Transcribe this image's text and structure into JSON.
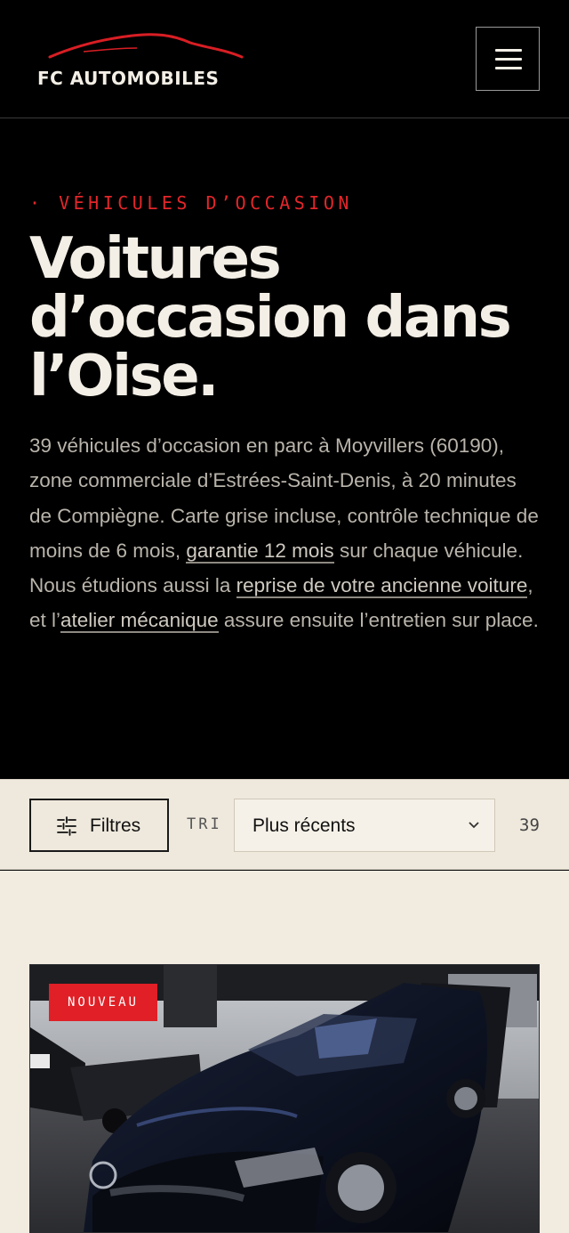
{
  "header": {
    "brand": "FC AUTOMOBILES",
    "logo_icon": "car-silhouette-icon",
    "menu_icon": "hamburger-menu-icon"
  },
  "hero": {
    "eyebrow": "· VÉHICULES D’OCCASION",
    "title_lines": [
      "Voitures",
      "d’occasion dans",
      "l’Oise."
    ],
    "description": {
      "part1": "39 véhicules d’occasion en parc à Moyvillers (60190), zone commerciale d’Estrées-Saint-Denis, à 20 minutes de Compiègne. Carte grise incluse, contrôle technique de moins de 6 mois, ",
      "link1": "garantie 12 mois",
      "part2": " sur chaque véhicule. Nous étudions aussi la ",
      "link2": "reprise de votre ancienne voiture",
      "part3": ", et l’",
      "link3": "atelier mécanique",
      "part4": " assure ensuite l’entretien sur place."
    }
  },
  "toolbar": {
    "filters_label": "Filtres",
    "filters_icon": "sliders-icon",
    "sort_label": "TRI",
    "sort_value": "Plus récents",
    "sort_icon": "chevron-down-icon",
    "result_count": "39"
  },
  "listing": {
    "cards": [
      {
        "badge": "NOUVEAU"
      }
    ]
  },
  "colors": {
    "background_dark": "#000000",
    "accent_red": "#e3262a",
    "cream": "#efe9dd",
    "text_light": "#f4efe6"
  }
}
